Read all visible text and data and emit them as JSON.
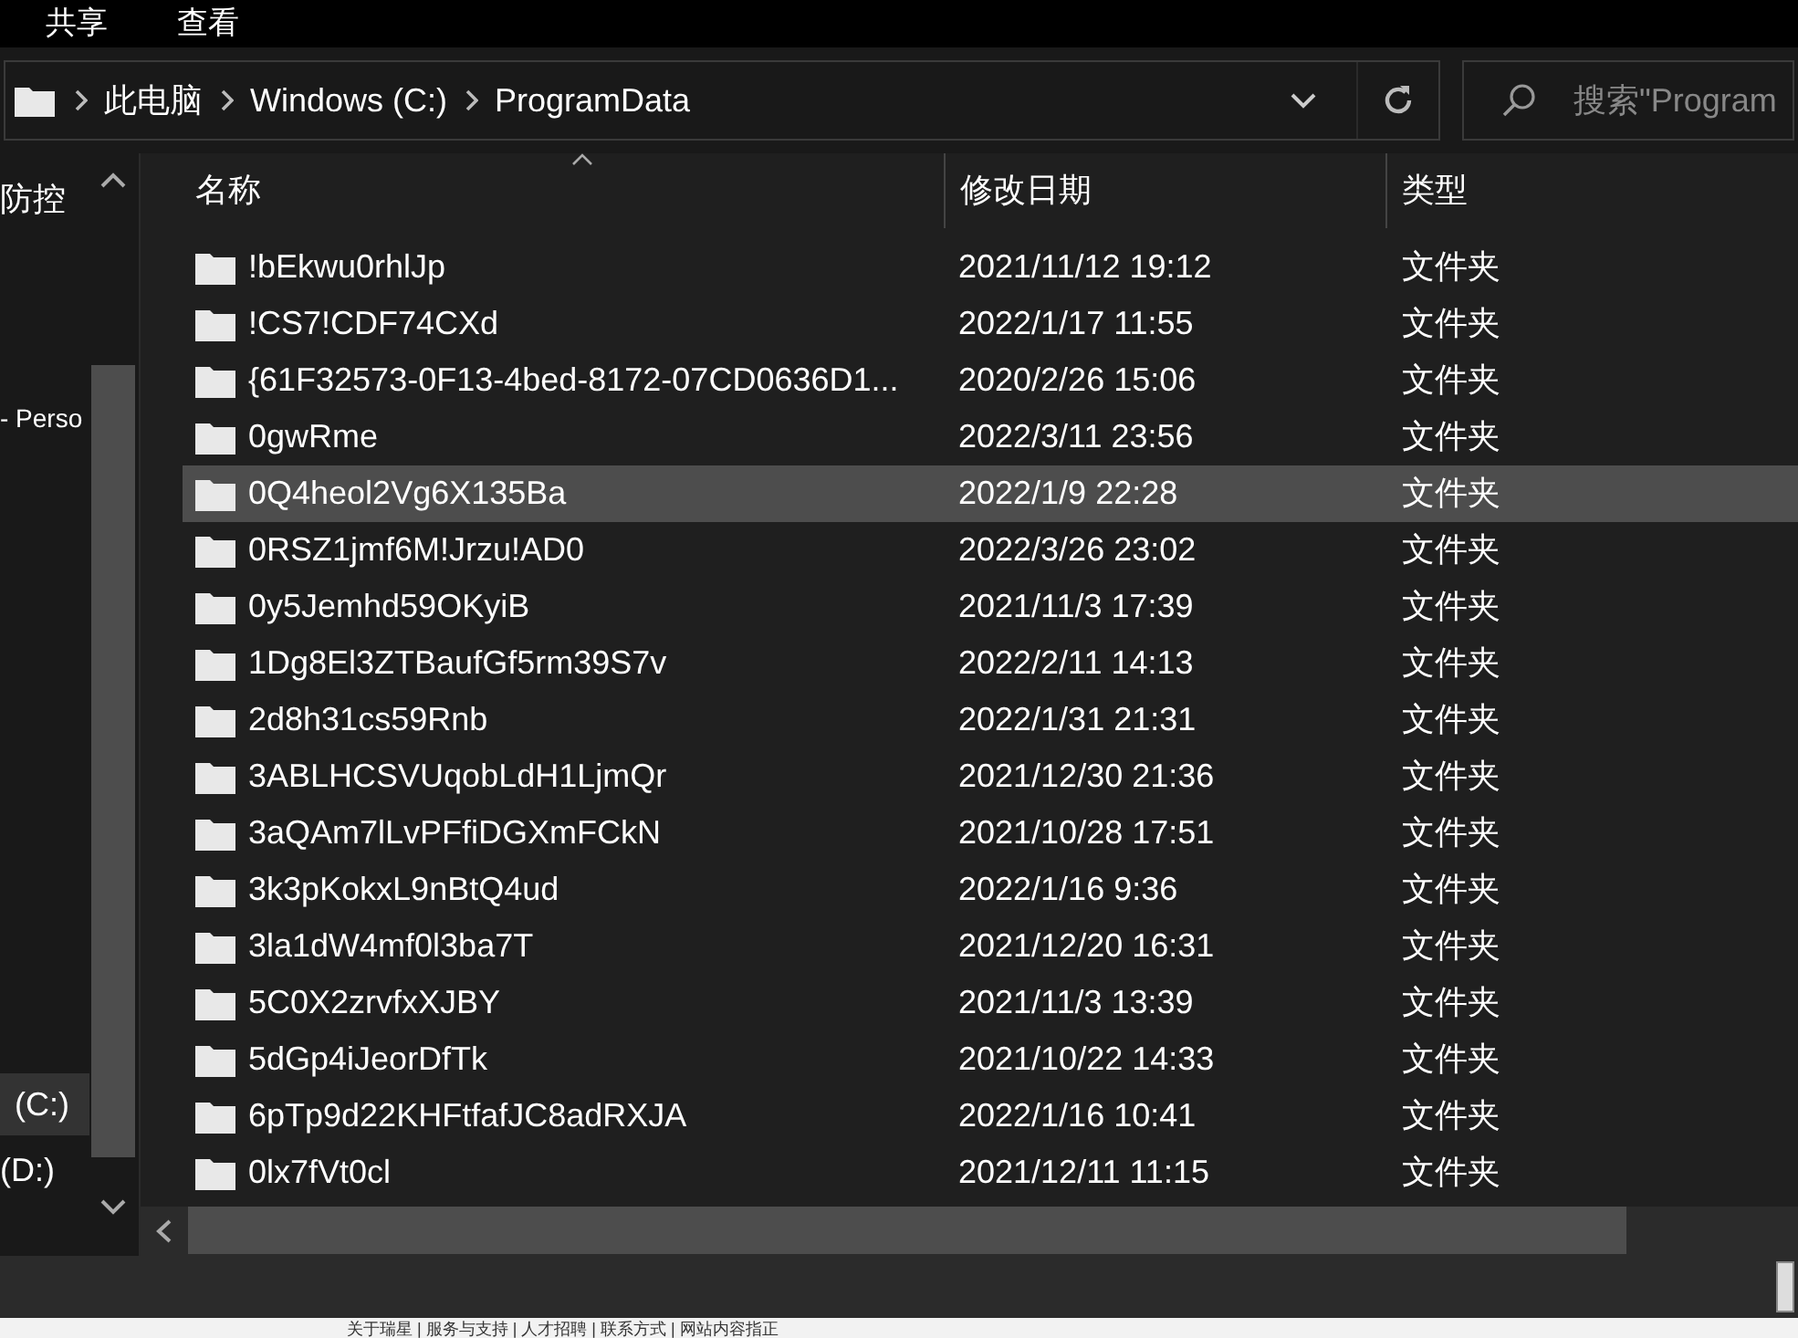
{
  "ribbon_tabs": [
    {
      "label": "共享"
    },
    {
      "label": "查看"
    }
  ],
  "address_bar": {
    "segments": [
      "此电脑",
      "Windows (C:)",
      "ProgramData"
    ]
  },
  "search": {
    "placeholder": "搜索\"Program"
  },
  "nav_pane": {
    "items": [
      {
        "label": "防控",
        "selected": false
      },
      {
        "label": "- Perso",
        "selected": false
      },
      {
        "label": "(C:)",
        "selected": true
      },
      {
        "label": "(D:)",
        "selected": false
      }
    ]
  },
  "columns": [
    "名称",
    "修改日期",
    "类型"
  ],
  "rows": [
    {
      "name": "!bEkwu0rhlJp",
      "date": "2021/11/12 19:12",
      "type": "文件夹",
      "selected": false
    },
    {
      "name": "!CS7!CDF74CXd",
      "date": "2022/1/17 11:55",
      "type": "文件夹",
      "selected": false
    },
    {
      "name": "{61F32573-0F13-4bed-8172-07CD0636D1...",
      "date": "2020/2/26 15:06",
      "type": "文件夹",
      "selected": false
    },
    {
      "name": "0gwRme",
      "date": "2022/3/11 23:56",
      "type": "文件夹",
      "selected": false
    },
    {
      "name": "0Q4heol2Vg6X135Ba",
      "date": "2022/1/9 22:28",
      "type": "文件夹",
      "selected": true
    },
    {
      "name": "0RSZ1jmf6M!Jrzu!AD0",
      "date": "2022/3/26 23:02",
      "type": "文件夹",
      "selected": false
    },
    {
      "name": "0y5Jemhd59OKyiB",
      "date": "2021/11/3 17:39",
      "type": "文件夹",
      "selected": false
    },
    {
      "name": "1Dg8El3ZTBaufGf5rm39S7v",
      "date": "2022/2/11 14:13",
      "type": "文件夹",
      "selected": false
    },
    {
      "name": "2d8h31cs59Rnb",
      "date": "2022/1/31 21:31",
      "type": "文件夹",
      "selected": false
    },
    {
      "name": "3ABLHCSVUqobLdH1LjmQr",
      "date": "2021/12/30 21:36",
      "type": "文件夹",
      "selected": false
    },
    {
      "name": "3aQAm7lLvPFfiDGXmFCkN",
      "date": "2021/10/28 17:51",
      "type": "文件夹",
      "selected": false
    },
    {
      "name": "3k3pKokxL9nBtQ4ud",
      "date": "2022/1/16 9:36",
      "type": "文件夹",
      "selected": false
    },
    {
      "name": "3la1dW4mf0l3ba7T",
      "date": "2021/12/20 16:31",
      "type": "文件夹",
      "selected": false
    },
    {
      "name": "5C0X2zrvfxXJBY",
      "date": "2021/11/3 13:39",
      "type": "文件夹",
      "selected": false
    },
    {
      "name": "5dGp4iJeorDfTk",
      "date": "2021/10/22 14:33",
      "type": "文件夹",
      "selected": false
    },
    {
      "name": "6pTp9d22KHFtfafJC8adRXJA",
      "date": "2022/1/16 10:41",
      "type": "文件夹",
      "selected": false
    },
    {
      "name": "0lx7fVt0cl",
      "date": "2021/12/11 11:15",
      "type": "文件夹",
      "selected": false
    }
  ],
  "footer_links": "关于瑞星 | 服务与支持 | 人才招聘 | 联系方式 | 网站内容指正"
}
